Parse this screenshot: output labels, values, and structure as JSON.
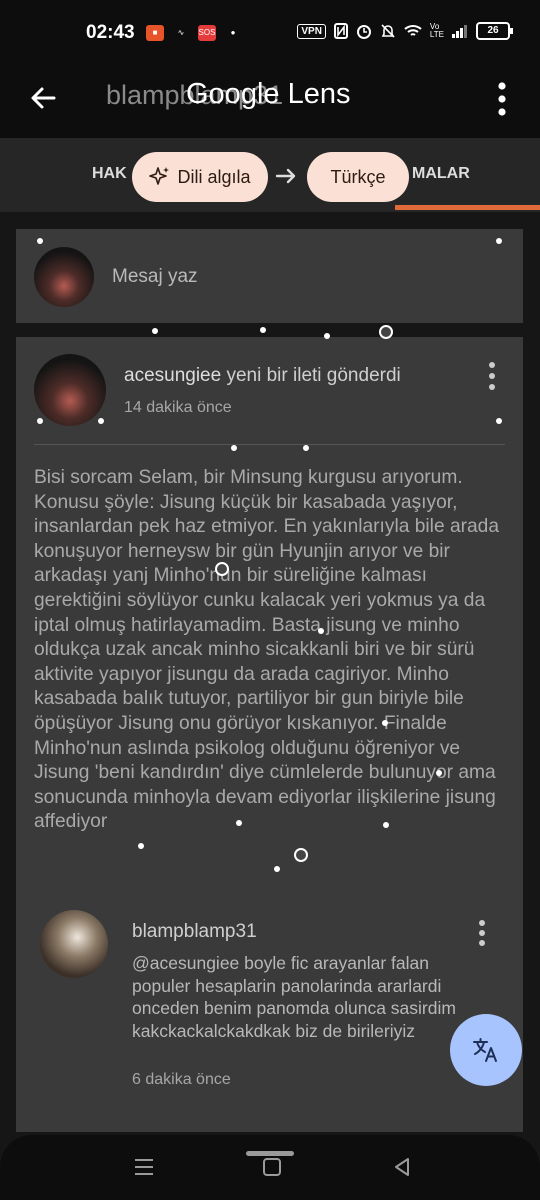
{
  "status_bar": {
    "time": "02:43",
    "vpn": "VPN",
    "battery": "26"
  },
  "app_bar": {
    "underlying_title": "blampblamp31",
    "title": "Google Lens"
  },
  "tabs": {
    "left_partial": "HAK",
    "right_partial": "MALAR"
  },
  "translate_bar": {
    "source_label": "Dili algıla",
    "target_label": "Türkçe"
  },
  "compose": {
    "placeholder": "Mesaj yaz"
  },
  "post": {
    "author": "acesungiee",
    "action": "yeni bir ileti gönderdi",
    "time": "14 dakika önce",
    "body": "Bisi sorcam Selam, bir Minsung kurgusu arıyorum. Konusu şöyle: Jisung küçük bir kasabada yaşıyor, insanlardan pek haz etmiyor. En yakınlarıyla bile arada konuşuyor herneysw bir gün Hyunjin arıyor ve bir arkadaşı yanj Minho'nun bir süreliğine kalması gerektiğini söylüyor cunku kalacak yeri yokmus ya da iptal olmuş hatirlayamadim. Basta jisung ve minho oldukça uzak ancak minho sicakkanli biri ve bir sürü aktivite yapıyor jisungu da arada cagiriyor. Minho kasabada balık tutuyor, partiliyor bir gun biriyle bile öpüşüyor Jisung onu görüyor kıskanıyor. Finalde Minho'nun aslında psikolog olduğunu öğreniyor ve Jisung 'beni kandırdın' diye cümlelerde bulunuyor ama sonucunda minhoyla devam ediyorlar ilişkilerine jisung affediyor"
  },
  "reply": {
    "author": "blampblamp31",
    "text": "@acesungiee  boyle fic arayanlar falan populer hesaplarin panolarinda ararlardi onceden benim panomda olunca sasirdim kakckackalckakdkak biz de birileriyiz",
    "time": "6 dakika önce"
  },
  "colors": {
    "accent": "#e06a3a",
    "chip": "#fbe0d5",
    "fab": "#a7c4ff"
  }
}
